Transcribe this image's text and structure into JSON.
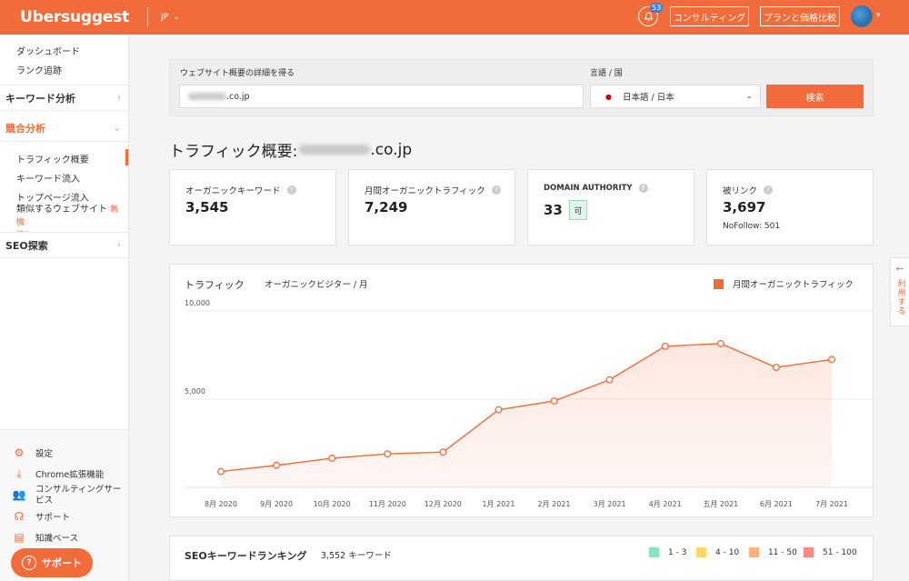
{
  "topbar": {
    "logo": "Ubersuggest",
    "lang": "JP",
    "notification_count": "53",
    "consulting_button": "コンサルティング",
    "pricing_button": "プランと価格比較"
  },
  "sidebar": {
    "dashboard": "ダッシュボード",
    "rank_tracking": "ランク追跡",
    "keyword_analysis": "キーワード分析",
    "competitor_analysis": "競合分析",
    "traffic_overview": "トラフィック概要",
    "keyword_inflow": "キーワード流入",
    "top_pages_inflow": "トップページ流入",
    "similar_sites": "類似するウェブサイト",
    "new_feature_a": "新機",
    "new_feature_b": "能！",
    "seo_explore": "SEO探索",
    "settings": "設定",
    "chrome_extension": "Chrome拡張機能",
    "consulting_a": "コンサルティングサー",
    "consulting_b": "ビス",
    "support_link": "サポート",
    "knowledge_base": "知識ベース",
    "support_button": "サポート"
  },
  "search": {
    "domain_label": "ウェブサイト概要の詳細を得る",
    "domain_value_suffix": ".co.jp",
    "lang_label": "言語 / 国",
    "lang_value": "日本語 / 日本",
    "search_button": "検索"
  },
  "page": {
    "title_prefix": "トラフィック概要:",
    "title_suffix": ".co.jp"
  },
  "stats": {
    "organic_keywords_label": "オーガニックキーワード",
    "organic_keywords_value": "3,545",
    "monthly_traffic_label": "月間オーガニックトラフィック",
    "monthly_traffic_value": "7,249",
    "domain_authority_label": "DOMAIN AUTHORITY",
    "domain_authority_value": "33",
    "domain_authority_badge": "可",
    "backlinks_label": "被リンク",
    "backlinks_value": "3,697",
    "nofollow": "NoFollow: 501"
  },
  "traffic_chart": {
    "title": "トラフィック",
    "subtitle": "オーガニックビジター / 月",
    "legend": "月間オーガニックトラフィック"
  },
  "chart_data": {
    "type": "area",
    "x": [
      "8月 2020",
      "9月 2020",
      "10月 2020",
      "11月 2020",
      "12月 2020",
      "1月 2021",
      "2月 2021",
      "3月 2021",
      "4月 2021",
      "五月 2021",
      "6月 2021",
      "7月 2021"
    ],
    "series": [
      {
        "name": "月間オーガニックトラフィック",
        "values": [
          900,
          1250,
          1650,
          1900,
          2000,
          4400,
          4900,
          6100,
          8000,
          8150,
          6800,
          7249
        ]
      }
    ],
    "yticks": [
      "5,000",
      "10,000"
    ],
    "ylim": [
      0,
      10000
    ],
    "grid": true,
    "legend": "top-right",
    "color": "#f26b3a"
  },
  "ranking": {
    "title": "SEOキーワードランキング",
    "count": "3,552 キーワード",
    "buckets": [
      {
        "label": "1 - 3",
        "color": "#86e6c0"
      },
      {
        "label": "4 - 10",
        "color": "#ffd66b"
      },
      {
        "label": "11 - 50",
        "color": "#ffb27d"
      },
      {
        "label": "51 - 100",
        "color": "#ff8a84"
      }
    ]
  },
  "side_tab": {
    "arrow": "←",
    "label": "利用する"
  }
}
